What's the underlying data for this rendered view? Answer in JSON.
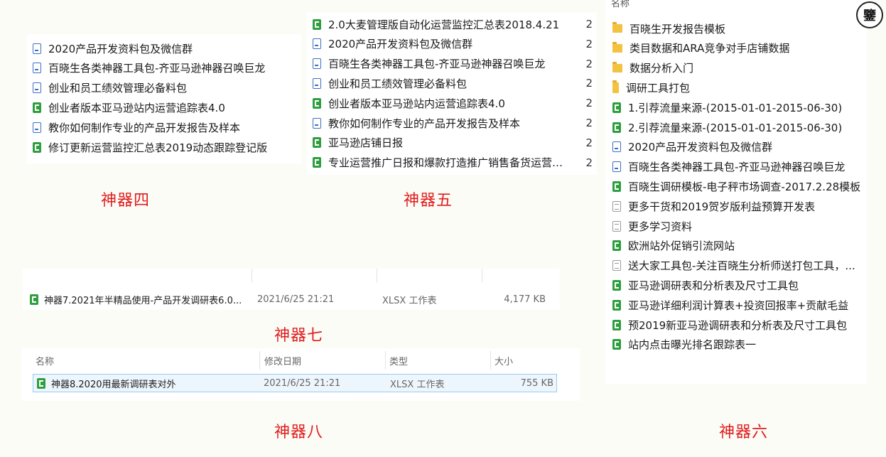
{
  "panel4": {
    "caption": "神器四",
    "items": [
      {
        "icon": "word-doc-icon",
        "type": "w",
        "label": "2020产品开发资料包及微信群"
      },
      {
        "icon": "word-doc-icon",
        "type": "w",
        "label": "百晓生各类神器工具包-齐亚马逊神器召唤巨龙"
      },
      {
        "icon": "word-doc-icon",
        "type": "w",
        "label": "创业和员工绩效管理必备料包"
      },
      {
        "icon": "excel-sheet-icon",
        "type": "x",
        "label": "创业者版本亚马逊站内运营追踪表4.0"
      },
      {
        "icon": "word-doc-icon",
        "type": "w",
        "label": "教你如何制作专业的产品开发报告及样本"
      },
      {
        "icon": "excel-sheet-icon",
        "type": "x",
        "label": "修订更新运营监控汇总表2019动态跟踪登记版"
      }
    ]
  },
  "panel5": {
    "caption": "神器五",
    "items": [
      {
        "icon": "excel-sheet-icon",
        "type": "x",
        "label": "2.0大麦管理版自动化运营监控汇总表2018.4.21",
        "num": "2"
      },
      {
        "icon": "word-doc-icon",
        "type": "w",
        "label": "2020产品开发资料包及微信群",
        "num": "2"
      },
      {
        "icon": "word-doc-icon",
        "type": "w",
        "label": "百晓生各类神器工具包-齐亚马逊神器召唤巨龙",
        "num": "2"
      },
      {
        "icon": "word-doc-icon",
        "type": "w",
        "label": "创业和员工绩效管理必备料包",
        "num": "2"
      },
      {
        "icon": "excel-sheet-icon",
        "type": "x",
        "label": "创业者版本亚马逊站内运营追踪表4.0",
        "num": "2"
      },
      {
        "icon": "word-doc-icon",
        "type": "w",
        "label": "教你如何制作专业的产品开发报告及样本",
        "num": "2"
      },
      {
        "icon": "excel-sheet-icon",
        "type": "x",
        "label": "亚马逊店铺日报",
        "num": "2"
      },
      {
        "icon": "excel-sheet-icon",
        "type": "x",
        "label": "专业运营推广日报和爆款打造推广销售备货运营…",
        "num": "2"
      }
    ]
  },
  "panel6": {
    "caption": "神器六",
    "header": "名称",
    "items": [
      {
        "icon": "folder-icon",
        "type": "folder",
        "label": "百晓生开发报告模板"
      },
      {
        "icon": "folder-icon",
        "type": "folder",
        "label": "类目数据和ARA竞争对手店铺数据"
      },
      {
        "icon": "folder-icon",
        "type": "folder",
        "label": "数据分析入门"
      },
      {
        "icon": "folder-icon",
        "type": "folder vert",
        "label": "调研工具打包"
      },
      {
        "icon": "excel-sheet-icon",
        "type": "x",
        "label": "1.引荐流量来源-(2015-01-01-2015-06-30)"
      },
      {
        "icon": "excel-sheet-icon",
        "type": "x",
        "label": "2.引荐流量来源-(2015-01-01-2015-06-30)"
      },
      {
        "icon": "word-doc-icon",
        "type": "w",
        "label": "2020产品开发资料包及微信群"
      },
      {
        "icon": "word-doc-icon",
        "type": "w",
        "label": "百晓生各类神器工具包-齐亚马逊神器召唤巨龙"
      },
      {
        "icon": "excel-sheet-icon",
        "type": "x",
        "label": "百晓生调研模板-电子秤市场调查-2017.2.28模板"
      },
      {
        "icon": "text-doc-icon",
        "type": "g",
        "label": "更多干货和2019贺岁版利益预算开发表"
      },
      {
        "icon": "text-doc-icon",
        "type": "g",
        "label": "更多学习资料"
      },
      {
        "icon": "excel-sheet-icon",
        "type": "x",
        "label": "欧洲站外促销引流网站"
      },
      {
        "icon": "text-doc-icon",
        "type": "g",
        "label": "送大家工具包-关注百晓生分析师送打包工具，..."
      },
      {
        "icon": "excel-sheet-icon",
        "type": "x",
        "label": "亚马逊调研表和分析表及尺寸工具包"
      },
      {
        "icon": "excel-sheet-icon",
        "type": "x",
        "label": "亚马逊详细利润计算表+投资回报率+贡献毛益"
      },
      {
        "icon": "excel-sheet-icon",
        "type": "x",
        "label": "预2019新亚马逊调研表和分析表及尺寸工具包"
      },
      {
        "icon": "excel-sheet-icon",
        "type": "x",
        "label": "站内点击曝光排名跟踪表一"
      }
    ]
  },
  "panel7": {
    "caption": "神器七",
    "file": {
      "name": "神器7.2021年半精品使用-产品开发调研表6.0...",
      "date": "2021/6/25 21:21",
      "type": "XLSX 工作表",
      "size": "4,177 KB"
    }
  },
  "panel8": {
    "caption": "神器八",
    "columns": {
      "name": "名称",
      "date": "修改日期",
      "type": "类型",
      "size": "大小"
    },
    "file": {
      "name": "神器8.2020用最新调研表对外",
      "date": "2021/6/25 21:21",
      "type": "XLSX 工作表",
      "size": "755 KB"
    }
  },
  "avatar": {
    "glyph": "鑒"
  },
  "colors": {
    "caption": "#e01e1e",
    "excel": "#2f9e3f",
    "word": "#3b6fc4",
    "folder": "#f4c242"
  }
}
